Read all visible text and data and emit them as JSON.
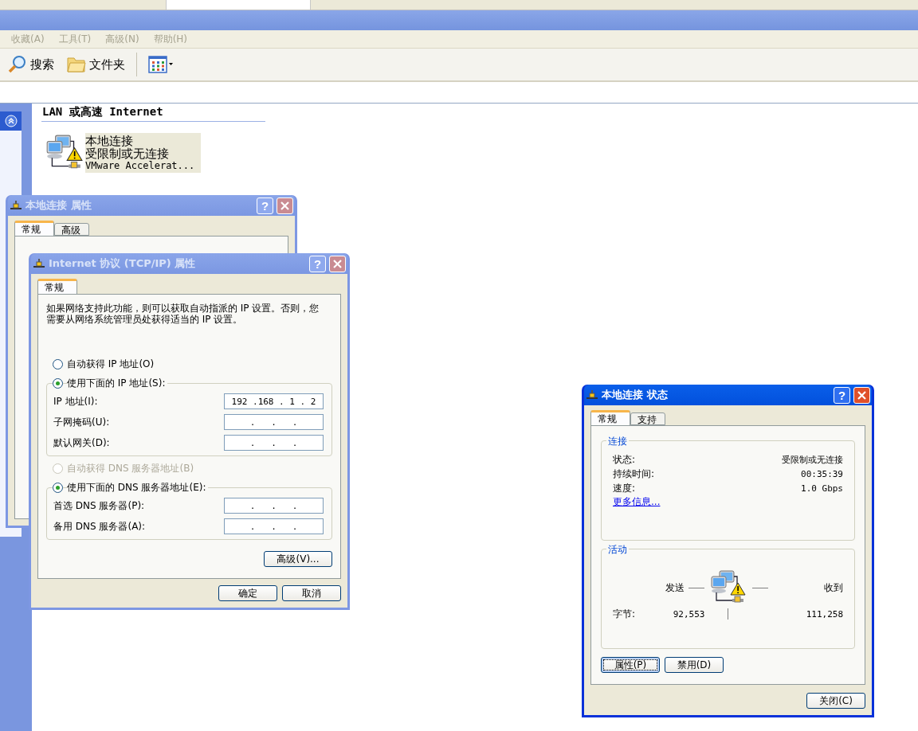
{
  "explorer": {
    "menu": [
      {
        "label": "收藏(A)"
      },
      {
        "label": "工具(T)"
      },
      {
        "label": "高级(N)"
      },
      {
        "label": "帮助(H)"
      }
    ],
    "toolbar": [
      {
        "kind": "search",
        "label": "搜索"
      },
      {
        "kind": "folders",
        "label": "文件夹"
      },
      {
        "kind": "views"
      }
    ],
    "section_title": "LAN 或高速 Internet",
    "connection": {
      "name": "本地连接",
      "status": "受限制或无连接",
      "device": "VMware Accelerat...",
      "selected": true
    }
  },
  "properties_dialog": {
    "title": "本地连接 属性",
    "active": false,
    "help": "?",
    "tabs": [
      {
        "label": "常规",
        "selected": true
      },
      {
        "label": "高级",
        "selected": false
      }
    ]
  },
  "tcpip_dialog": {
    "title": "Internet 协议 (TCP/IP) 属性",
    "active": false,
    "help": "?",
    "tabs": [
      {
        "label": "常规",
        "selected": true
      }
    ],
    "description": "如果网络支持此功能，则可以获取自动指派的 IP 设置。否则，您需要从网络系统管理员处获得适当的 IP 设置。",
    "ip_options": [
      {
        "label": "自动获得 IP 地址(O)",
        "selected": false,
        "disabled": false
      },
      {
        "label": "使用下面的 IP 地址(S):",
        "selected": true,
        "disabled": false,
        "fields": [
          {
            "label": "IP 地址(I):",
            "value": "192 .168 . 1 . 2"
          },
          {
            "label": "子网掩码(U):",
            "value": ".   .   ."
          },
          {
            "label": "默认网关(D):",
            "value": ".   .   ."
          }
        ]
      }
    ],
    "dns_options": [
      {
        "label": "自动获得 DNS 服务器地址(B)",
        "selected": false,
        "disabled": true
      },
      {
        "label": "使用下面的 DNS 服务器地址(E):",
        "selected": true,
        "disabled": false,
        "fields": [
          {
            "label": "首选 DNS 服务器(P):",
            "value": ".   .   ."
          },
          {
            "label": "备用 DNS 服务器(A):",
            "value": ".   .   ."
          }
        ]
      }
    ],
    "advanced_button": "高级(V)...",
    "buttons": [
      "确定",
      "取消"
    ]
  },
  "status_dialog": {
    "title": "本地连接 状态",
    "active": true,
    "help": "?",
    "tabs": [
      {
        "label": "常规",
        "selected": true
      },
      {
        "label": "支持",
        "selected": false
      }
    ],
    "connection_group": {
      "title": "连接",
      "rows": [
        {
          "label": "状态:",
          "value": "受限制或无连接"
        },
        {
          "label": "持续时间:",
          "value": "00:35:39"
        },
        {
          "label": "速度:",
          "value": "1.0 Gbps"
        }
      ],
      "link": "更多信息..."
    },
    "activity_group": {
      "title": "活动",
      "sent_label": "发送",
      "received_label": "收到",
      "bytes_label": "字节:",
      "sent": "92,553",
      "received": "111,258"
    },
    "buttons": [
      {
        "label": "属性(P)",
        "focused": true
      },
      {
        "label": "禁用(D)",
        "focused": false
      }
    ],
    "close_button": "关闭(C)"
  }
}
